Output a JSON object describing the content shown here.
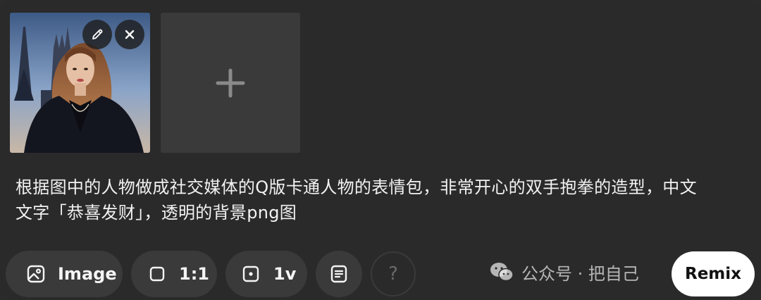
{
  "attachments": {
    "edit_icon": "pencil-icon",
    "remove_icon": "close-icon",
    "add_icon": "plus-icon"
  },
  "prompt": {
    "text": "根据图中的人物做成社交媒体的Q版卡通人物的表情包，非常开心的双手抱拳的造型，中文\n文字「恭喜发财」，透明的背景png图"
  },
  "toolbar": {
    "image_label": "Image",
    "image_icon": "image-icon",
    "aspect_label": "1:1",
    "aspect_icon": "square-icon",
    "version_label": "1v",
    "version_icon": "dot-square-icon",
    "preset_icon": "preset-list-icon",
    "help_label": "?",
    "remix_label": "Remix"
  },
  "watermark": {
    "text": "公众号 · 把自己",
    "icon": "wechat-icon"
  },
  "colors": {
    "background": "#2a2a2a",
    "chip": "#3a3a3a",
    "text": "#f2f2f2",
    "remix_bg": "#ffffff"
  }
}
